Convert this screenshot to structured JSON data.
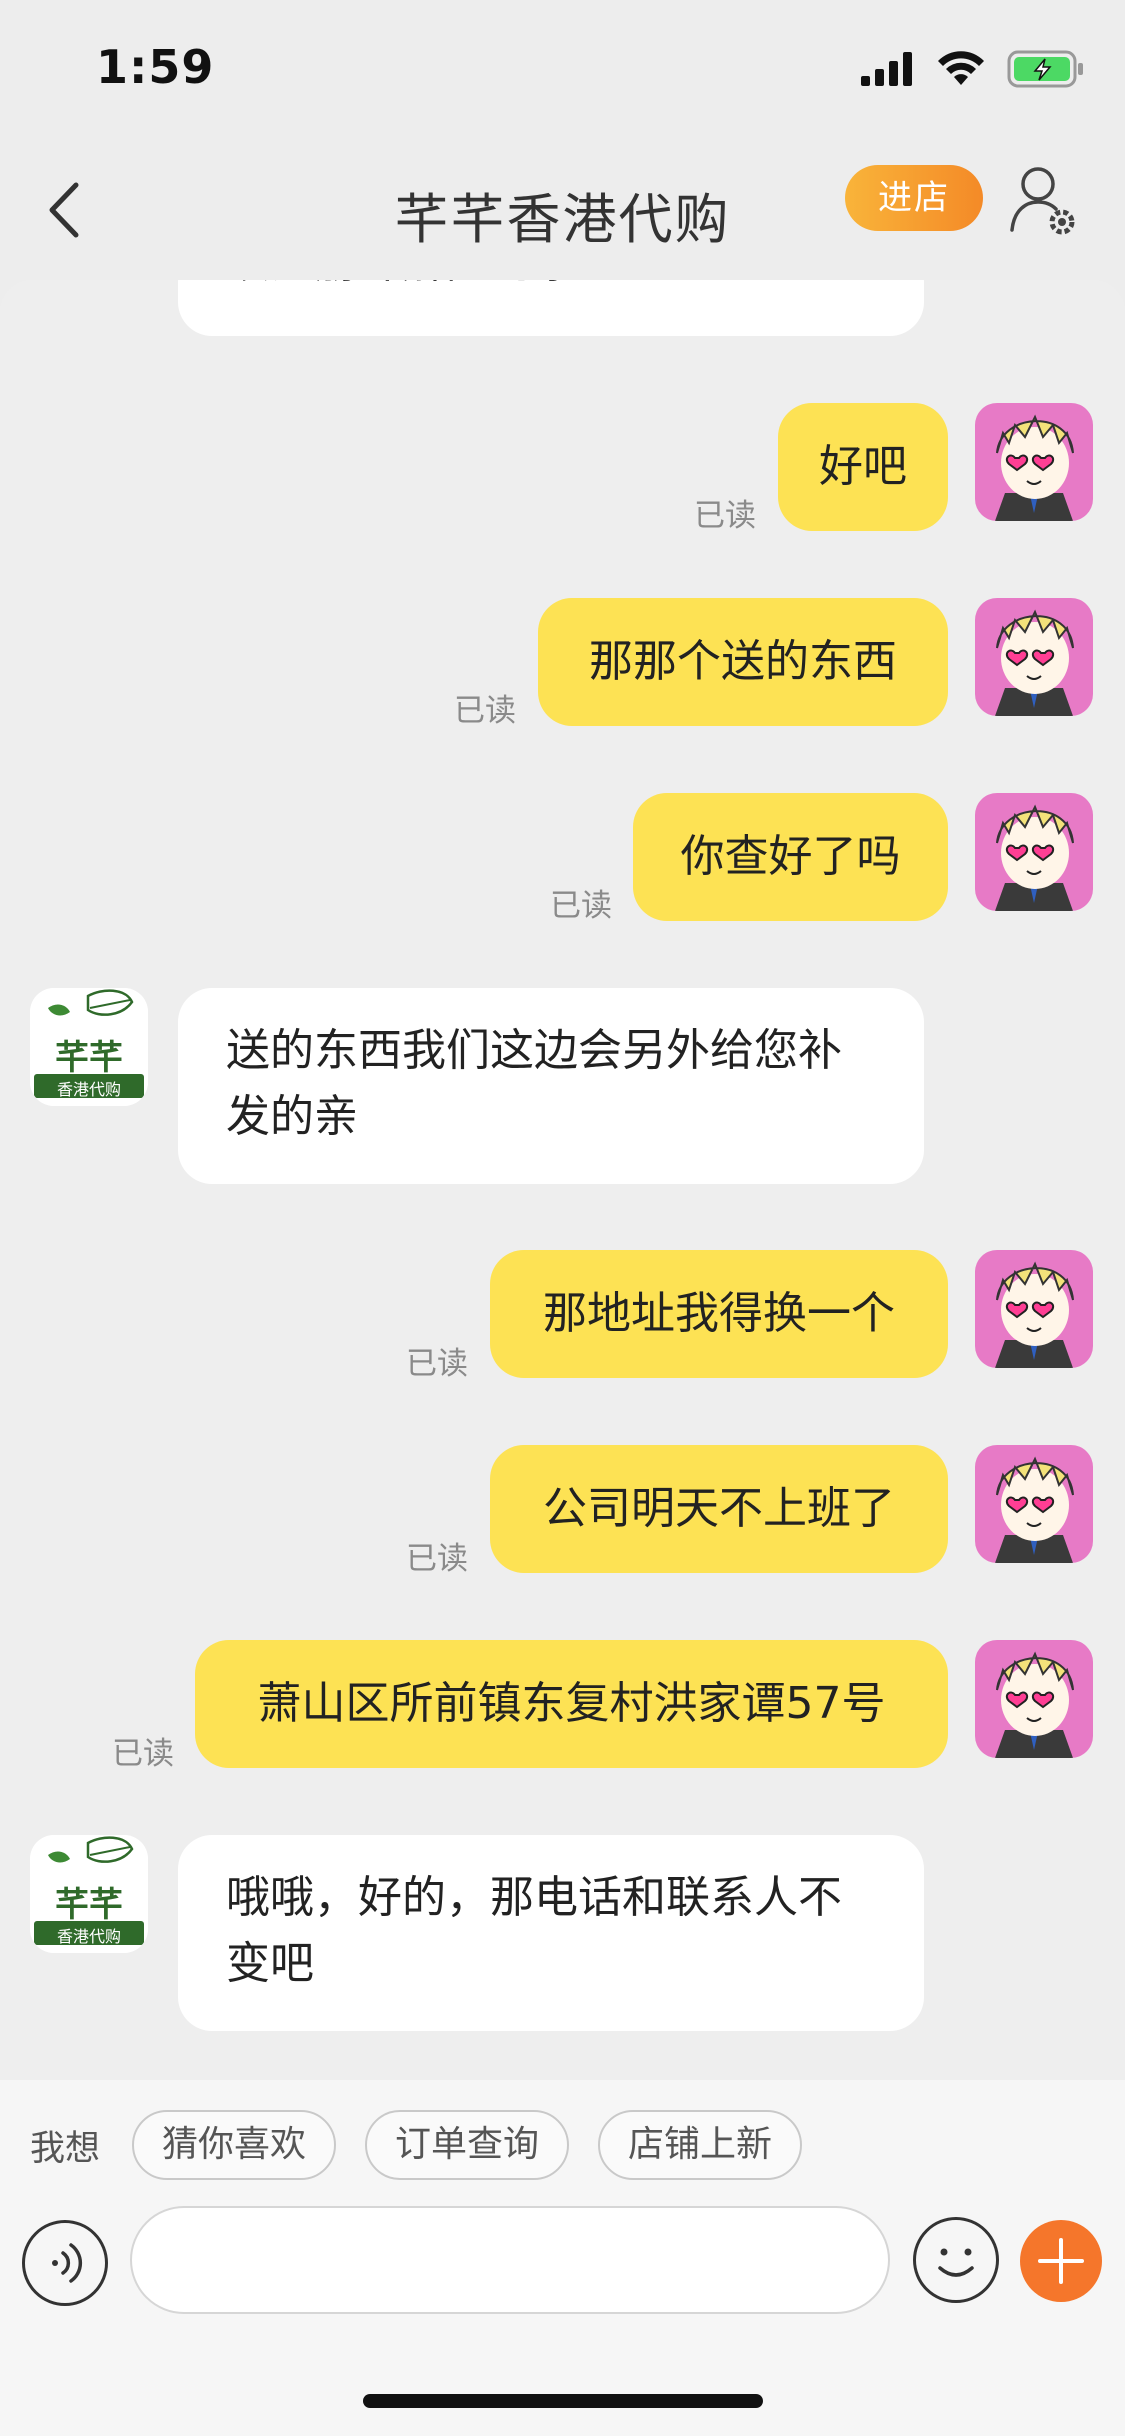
{
  "status_bar": {
    "time": "1:59"
  },
  "nav": {
    "title": "芊芊香港代购",
    "store_button": "进店"
  },
  "messages": [
    {
      "side": "them",
      "text": "以注册详解险的亲"
    },
    {
      "side": "me",
      "text": "好吧",
      "status": "已读"
    },
    {
      "side": "me",
      "text": "那那个送的东西",
      "status": "已读"
    },
    {
      "side": "me",
      "text": "你查好了吗",
      "status": "已读"
    },
    {
      "side": "them",
      "text": "送的东西我们这边会另外给您补发的亲"
    },
    {
      "side": "me",
      "text": "那地址我得换一个",
      "status": "已读"
    },
    {
      "side": "me",
      "text": "公司明天不上班了",
      "status": "已读"
    },
    {
      "side": "me",
      "text": "萧山区所前镇东复村洪家谭57号",
      "status": "已读"
    },
    {
      "side": "them",
      "text": "哦哦，好的，那电话和联系人不变吧"
    }
  ],
  "shop_avatar": {
    "name": "芊芊",
    "sub": "香港代购"
  },
  "suggestions": {
    "label": "我想",
    "chips": [
      "猜你喜欢",
      "订单查询",
      "店铺上新"
    ]
  },
  "colors": {
    "my_bubble": "#fde254",
    "store_button": "#f48a27",
    "plus_button": "#f5762b"
  }
}
